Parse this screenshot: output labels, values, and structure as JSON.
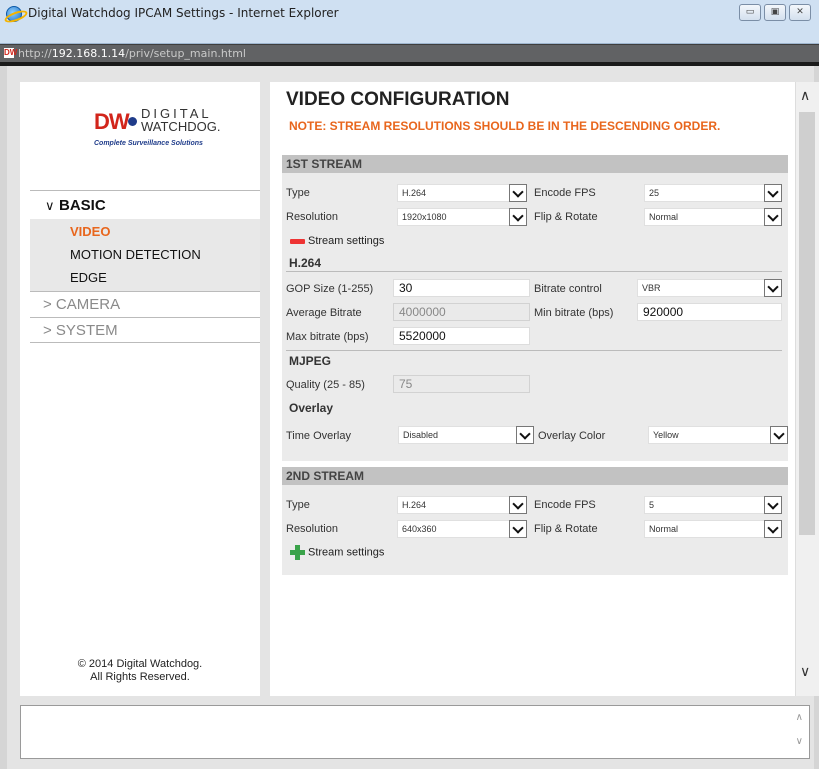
{
  "window": {
    "title": "Digital Watchdog IPCAM Settings - Internet Explorer",
    "url_prefix": "http://",
    "url_host": "192.168.1.14",
    "url_path": "/priv/setup_main.html",
    "minimize": "▭",
    "maximize": "▣",
    "close": "✕"
  },
  "logo": {
    "mark": "DW",
    "line1": "DIGITAL",
    "line2": "WATCHDOG.",
    "tagline": "Complete Surveillance Solutions"
  },
  "sidebar": {
    "basic_chevron": "∨",
    "basic_label": "BASIC",
    "basic_items": [
      "VIDEO",
      "MOTION DETECTION",
      "EDGE"
    ],
    "camera_label": "> CAMERA",
    "system_label": "> SYSTEM",
    "copyright_line1": "© 2014 Digital Watchdog.",
    "copyright_line2": "All Rights Reserved."
  },
  "main": {
    "title": "VIDEO CONFIGURATION",
    "note": "NOTE: STREAM RESOLUTIONS SHOULD BE IN THE DESCENDING ORDER."
  },
  "stream1": {
    "header": "1ST STREAM",
    "type_label": "Type",
    "type_value": "H.264",
    "encode_fps_label": "Encode FPS",
    "encode_fps_value": "25",
    "resolution_label": "Resolution",
    "resolution_value": "1920x1080",
    "flip_label": "Flip & Rotate",
    "flip_value": "Normal",
    "stream_settings": "Stream settings",
    "h264_title": "H.264",
    "gop_label": "GOP Size (1-255)",
    "gop_value": "30",
    "bitrate_control_label": "Bitrate control",
    "bitrate_control_value": "VBR",
    "avg_bitrate_label": "Average Bitrate",
    "avg_bitrate_value": "4000000",
    "min_bitrate_label": "Min bitrate (bps)",
    "min_bitrate_value": "920000",
    "max_bitrate_label": "Max bitrate (bps)",
    "max_bitrate_value": "5520000",
    "mjpeg_title": "MJPEG",
    "quality_label": "Quality (25 - 85)",
    "quality_value": "75",
    "overlay_title": "Overlay",
    "time_overlay_label": "Time Overlay",
    "time_overlay_value": "Disabled",
    "overlay_color_label": "Overlay Color",
    "overlay_color_value": "Yellow"
  },
  "stream2": {
    "header": "2ND STREAM",
    "type_label": "Type",
    "type_value": "H.264",
    "encode_fps_label": "Encode FPS",
    "encode_fps_value": "5",
    "resolution_label": "Resolution",
    "resolution_value": "640x360",
    "flip_label": "Flip & Rotate",
    "flip_value": "Normal",
    "stream_settings": "Stream settings"
  },
  "scroll": {
    "up": "∧",
    "down": "∨"
  },
  "colors": {
    "accent_orange": "#e8661d",
    "brand_red": "#d2251b",
    "brand_blue": "#1f3c8a"
  }
}
